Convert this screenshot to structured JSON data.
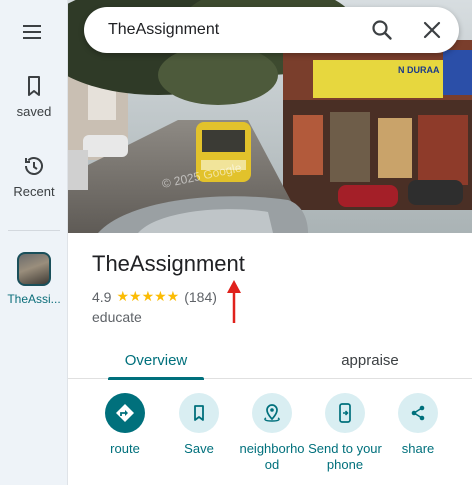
{
  "sidebar": {
    "menu_icon": "menu-icon",
    "items": [
      {
        "id": "saved",
        "label": "saved",
        "icon": "bookmark-icon"
      },
      {
        "id": "recent",
        "label": "Recent",
        "icon": "history-icon"
      }
    ],
    "recent_place": {
      "label": "TheAssi..."
    }
  },
  "search": {
    "value": "TheAssignment",
    "search_icon": "search-icon",
    "close_icon": "close-icon"
  },
  "photo": {
    "watermark": "© 2025 Google",
    "sign_text": "N DURAA"
  },
  "place": {
    "name": "TheAssignment",
    "rating": "4.9",
    "stars": "★★★★★",
    "review_count": "(184)",
    "category": "educate"
  },
  "tabs": [
    {
      "label": "Overview",
      "active": true
    },
    {
      "label": "appraise",
      "active": false
    }
  ],
  "actions": [
    {
      "label": "route",
      "icon": "directions-icon"
    },
    {
      "label": "Save",
      "icon": "bookmark-icon"
    },
    {
      "label": "neighborho od",
      "icon": "nearby-icon"
    },
    {
      "label": "Send to your phone",
      "icon": "send-to-phone-icon"
    },
    {
      "label": "share",
      "icon": "share-icon"
    }
  ],
  "colors": {
    "accent": "#00707c",
    "sidebar_bg": "#eef3f8",
    "star": "#fbbc04",
    "annotation_arrow": "#e0211c"
  }
}
